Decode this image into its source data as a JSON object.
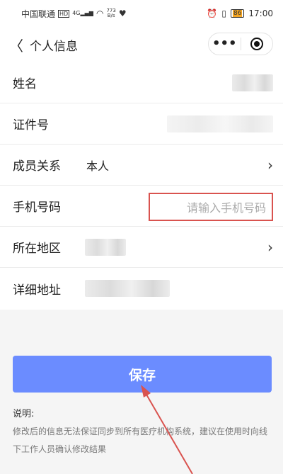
{
  "status_bar": {
    "carrier": "中国联通",
    "hd": "HD",
    "signal": "4G",
    "speed_value": "773",
    "speed_unit": "B/s",
    "battery": "86",
    "time": "17:00"
  },
  "nav": {
    "title": "个人信息",
    "more": "•••"
  },
  "form": {
    "name_label": "姓名",
    "id_label": "证件号",
    "relation_label": "成员关系",
    "relation_value": "本人",
    "phone_label": "手机号码",
    "phone_placeholder": "请输入手机号码",
    "region_label": "所在地区",
    "address_label": "详细地址"
  },
  "actions": {
    "save_label": "保存"
  },
  "notes": {
    "title": "说明:",
    "text": "修改后的信息无法保证同步到所有医疗机构系统，建议在使用时向线下工作人员确认修改结果"
  },
  "colors": {
    "accent": "#6b8cff",
    "highlight": "#d9534f"
  }
}
